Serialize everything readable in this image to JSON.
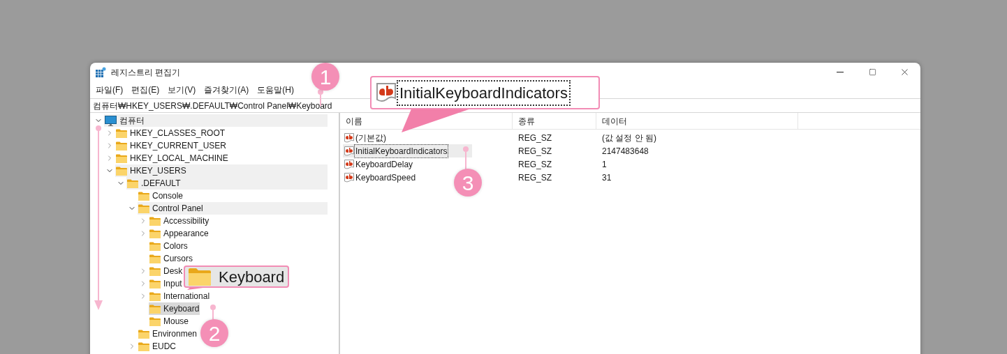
{
  "window": {
    "title": "레지스트리 편집기"
  },
  "menu": [
    "파일(F)",
    "편집(E)",
    "보기(V)",
    "즐겨찾기(A)",
    "도움말(H)"
  ],
  "address": "컴퓨터₩HKEY_USERS₩.DEFAULT₩Control Panel₩Keyboard",
  "tree": {
    "label": "컴퓨터",
    "kind": "computer",
    "expanded": true,
    "highlighted": true,
    "selected": false,
    "children": [
      {
        "label": "HKEY_CLASSES_ROOT",
        "kind": "key",
        "expanded": false,
        "highlighted": false,
        "selected": false
      },
      {
        "label": "HKEY_CURRENT_USER",
        "kind": "key",
        "expanded": false,
        "highlighted": false,
        "selected": false
      },
      {
        "label": "HKEY_LOCAL_MACHINE",
        "kind": "key",
        "expanded": false,
        "highlighted": false,
        "selected": false
      },
      {
        "label": "HKEY_USERS",
        "kind": "key",
        "expanded": true,
        "highlighted": true,
        "selected": false,
        "children": [
          {
            "label": ".DEFAULT",
            "kind": "key",
            "expanded": true,
            "highlighted": true,
            "selected": false,
            "children": [
              {
                "label": "Console",
                "kind": "key",
                "highlighted": false,
                "selected": false
              },
              {
                "label": "Control Panel",
                "kind": "key",
                "expanded": true,
                "highlighted": true,
                "selected": false,
                "children": [
                  {
                    "label": "Accessibility",
                    "kind": "key",
                    "expanded": false,
                    "highlighted": false,
                    "selected": false
                  },
                  {
                    "label": "Appearance",
                    "kind": "key",
                    "expanded": false,
                    "highlighted": false,
                    "selected": false
                  },
                  {
                    "label": "Colors",
                    "kind": "key",
                    "highlighted": false,
                    "selected": false
                  },
                  {
                    "label": "Cursors",
                    "kind": "key",
                    "highlighted": false,
                    "selected": false
                  },
                  {
                    "label": "Desk",
                    "kind": "key",
                    "expanded": false,
                    "highlighted": false,
                    "selected": false
                  },
                  {
                    "label": "Input",
                    "kind": "key",
                    "expanded": false,
                    "highlighted": false,
                    "selected": false
                  },
                  {
                    "label": "International",
                    "kind": "key",
                    "expanded": false,
                    "highlighted": false,
                    "selected": false
                  },
                  {
                    "label": "Keyboard",
                    "kind": "key",
                    "highlighted": false,
                    "selected": true
                  },
                  {
                    "label": "Mouse",
                    "kind": "key",
                    "highlighted": false,
                    "selected": false
                  }
                ]
              },
              {
                "label": "Environmen",
                "kind": "key",
                "highlighted": false,
                "selected": false
              },
              {
                "label": "EUDC",
                "kind": "key",
                "expanded": false,
                "highlighted": false,
                "selected": false
              }
            ]
          }
        ]
      }
    ]
  },
  "values": {
    "columns": [
      "이름",
      "종류",
      "데이터"
    ],
    "rows": [
      {
        "name": "(기본값)",
        "type": "REG_SZ",
        "data": "(값 설정 안 됨)",
        "selected": false
      },
      {
        "name": "InitialKeyboardIndicators",
        "type": "REG_SZ",
        "data": "2147483648",
        "selected": true
      },
      {
        "name": "KeyboardDelay",
        "type": "REG_SZ",
        "data": "1",
        "selected": false
      },
      {
        "name": "KeyboardSpeed",
        "type": "REG_SZ",
        "data": "31",
        "selected": false
      }
    ]
  },
  "annotations": {
    "steps": [
      "1",
      "2",
      "3"
    ],
    "magnified": [
      {
        "kind": "value",
        "text": "InitialKeyboardIndicators"
      },
      {
        "kind": "key",
        "text": "Keyboard"
      }
    ]
  }
}
